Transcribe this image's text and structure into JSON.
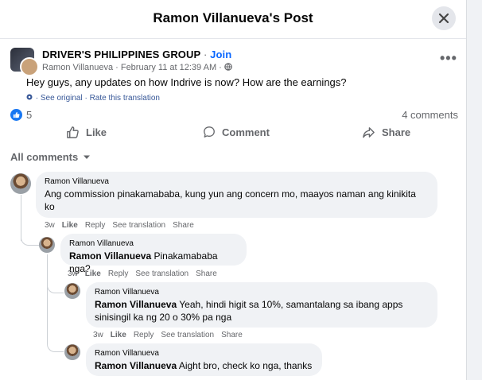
{
  "header": {
    "title": "Ramon Villanueva's Post"
  },
  "post": {
    "group_name": "DRIVER'S PHILIPPINES GROUP",
    "separator": " · ",
    "join_label": "Join",
    "author_meta": "Ramon Villanueva · February 11 at 12:39 AM ·",
    "body": "Hey guys, any updates on how Indrive is now? How are the earnings?",
    "see_original": "· See original · Rate this translation",
    "like_count": "5",
    "comment_count": "4 comments"
  },
  "actions": {
    "like": "Like",
    "comment": "Comment",
    "share": "Share"
  },
  "comments_filter": "All comments",
  "comments": [
    {
      "name": "Ramon Villanueva",
      "mention": "",
      "text": "Ang commission pinakamababa, kung yun ang concern mo, maayos naman ang kinikita ko",
      "time": "3w",
      "like": "Like",
      "reply": "Reply",
      "see_translation": "See translation",
      "share": "Share"
    },
    {
      "name": "Ramon Villanueva",
      "mention": "Ramon Villanueva",
      "text": " Pinakamababa nga?",
      "time": "3w",
      "like": "Like",
      "reply": "Reply",
      "see_translation": "See translation",
      "share": "Share"
    },
    {
      "name": "Ramon Villanueva",
      "mention": "Ramon Villanueva",
      "text": " Yeah, hindi higit sa 10%, samantalang sa ibang apps sinisingil ka ng 20 o 30% pa nga",
      "time": "3w",
      "like": "Like",
      "reply": "Reply",
      "see_translation": "See translation",
      "share": "Share"
    },
    {
      "name": "Ramon Villanueva",
      "mention": "Ramon Villanueva",
      "text": " Aight bro, check ko nga, thanks"
    }
  ],
  "colors": {
    "accent": "#0866ff",
    "bubble": "#f0f2f5",
    "muted": "#65676b"
  }
}
